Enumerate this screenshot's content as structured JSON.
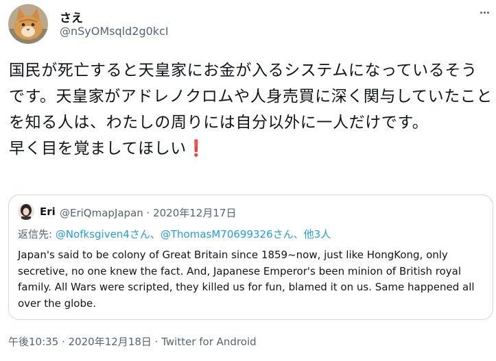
{
  "author": {
    "display_name": "さえ",
    "handle": "@nSyOMsqld2g0kcI"
  },
  "tweet": {
    "text": "国民が死亡すると天皇家にお金が入るシステムになっているそうです。天皇家がアドレノクロムや人身売買に深く関与していたことを知る人は、わたしの周りには自分以外に一人だけです。\n早く目を覚ましてほしい",
    "emoji": "❗"
  },
  "quoted": {
    "name": "Eri",
    "handle": "@EriQmapJapan",
    "separator": " · ",
    "date": "2020年12月17日",
    "reply_prefix": "返信先: ",
    "reply_user1": "@Nofksgiven4",
    "reply_san1": "さん、",
    "reply_user2": "@ThomasM70699326",
    "reply_san2": "さん、",
    "reply_others": "他3人",
    "text": "Japan's said to be colony of Great Britain since 1859~now, just like HongKong, only secretive, no one knew the fact. And, Japanese Emperor's been minion of British royal family. All Wars were scripted, they killed us for fun, blamed it on us. Same happened all over the globe."
  },
  "footer": {
    "time": "午後10:35",
    "separator": " · ",
    "date": "2020年12月18日",
    "source": "Twitter for Android",
    "source_prefix": " · "
  },
  "icons": {
    "more": "more-horizontal-icon",
    "avatar": "cat-photo",
    "quoted_avatar": "person-photo"
  }
}
